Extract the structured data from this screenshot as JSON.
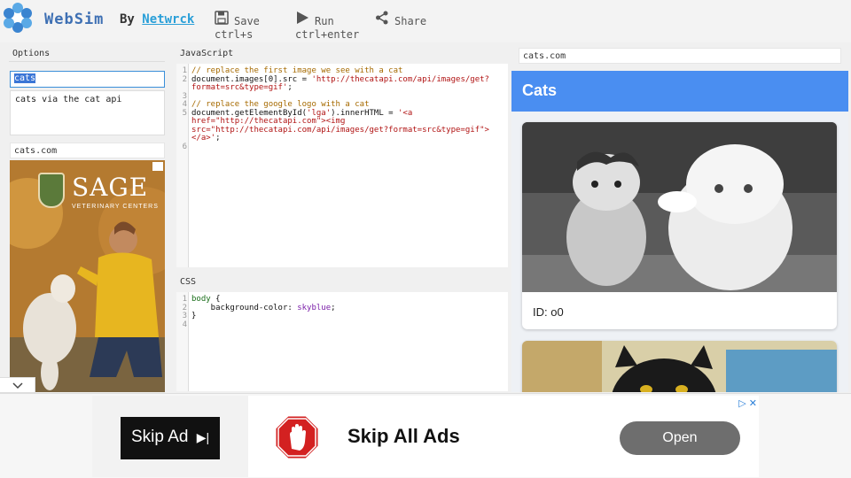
{
  "header": {
    "brand": "WebSim",
    "by_label": "By",
    "author": "Netwrck",
    "tools": [
      {
        "label": "Save",
        "shortcut": "ctrl+s",
        "icon": "save-icon"
      },
      {
        "label": "Run",
        "shortcut": "ctrl+enter",
        "icon": "run-icon"
      },
      {
        "label": "Share",
        "shortcut": "",
        "icon": "share-icon"
      }
    ]
  },
  "options": {
    "title": "Options",
    "name_value": "cats",
    "description": "cats via the cat api",
    "ad_panel_title": "cats.com",
    "ad_brand": "SAGE",
    "ad_brand_sub": "VETERINARY CENTERS"
  },
  "javascript": {
    "title": "JavaScript",
    "lines": [
      {
        "n": "1",
        "text": "// replace the first image we see with a cat",
        "type": "comment"
      },
      {
        "n": "2",
        "text": "document.images[0].src = ",
        "str": "'http://thecatapi.com/api/images/get?",
        "type": "code"
      },
      {
        "n": "",
        "text": "",
        "str": "format=src&type=gif'",
        "tail": ";",
        "type": "code"
      },
      {
        "n": "3",
        "text": "",
        "type": "code"
      },
      {
        "n": "4",
        "text": "// replace the google logo with a cat",
        "type": "comment"
      },
      {
        "n": "5",
        "text": "document.getElementById(",
        "str": "'lga'",
        "tail": ").innerHTML = ",
        "str2": "'<a",
        "type": "code"
      },
      {
        "n": "",
        "text": "",
        "str": "href=\"http://thecatapi.com\"><img",
        "type": "code"
      },
      {
        "n": "",
        "text": "",
        "str": "src=\"http://thecatapi.com/api/images/get?format=src&type=gif\">",
        "type": "code"
      },
      {
        "n": "",
        "text": "",
        "str": "</a>'",
        "tail": ";",
        "type": "code"
      },
      {
        "n": "6",
        "text": "",
        "type": "code"
      }
    ]
  },
  "css": {
    "title": "CSS",
    "lines": [
      {
        "n": "1",
        "sel": "body",
        "text": " {"
      },
      {
        "n": "2",
        "prop": "    background-color",
        "text": ": ",
        "val": "skyblue",
        "tail": ";"
      },
      {
        "n": "3",
        "text": "}"
      },
      {
        "n": "4",
        "text": ""
      }
    ]
  },
  "preview": {
    "url": "cats.com",
    "page_title": "Cats",
    "cards": [
      {
        "id_label": "ID: o0"
      }
    ]
  },
  "bottom_ad": {
    "skip_label": "Skip Ad",
    "skip_glyph": "▶|",
    "headline": "Skip All Ads",
    "open_label": "Open",
    "close_glyph": "▷ ✕"
  }
}
